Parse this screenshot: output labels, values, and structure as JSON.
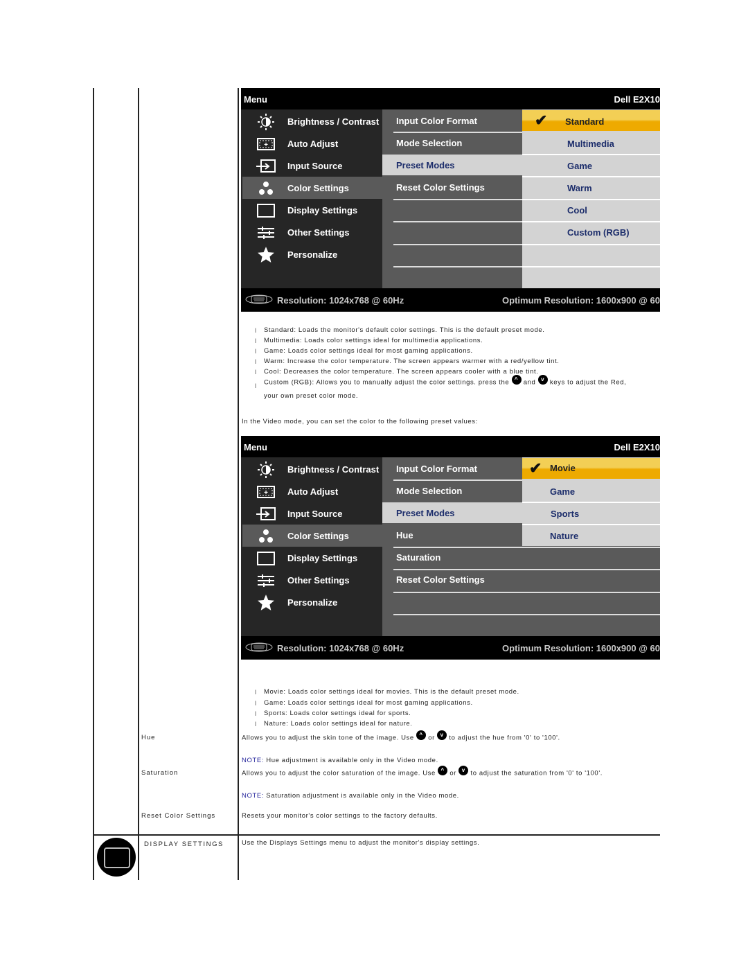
{
  "osd1": {
    "menu_label": "Menu",
    "model": "Dell E2X10",
    "left_items": [
      {
        "label": "Brightness / Contrast",
        "icon": "brightness-icon"
      },
      {
        "label": "Auto Adjust",
        "icon": "auto-adjust-icon"
      },
      {
        "label": "Input Source",
        "icon": "input-source-icon"
      },
      {
        "label": "Color Settings",
        "icon": "color-settings-icon",
        "active": true
      },
      {
        "label": "Display Settings",
        "icon": "display-settings-icon"
      },
      {
        "label": "Other Settings",
        "icon": "other-settings-icon"
      },
      {
        "label": "Personalize",
        "icon": "star-icon"
      }
    ],
    "mid_items": [
      "Input Color Format",
      "Mode Selection",
      "Preset Modes",
      "Reset Color Settings"
    ],
    "mid_selected": "Preset Modes",
    "right_items": [
      "Standard",
      "Multimedia",
      "Game",
      "Warm",
      "Cool",
      "Custom (RGB)"
    ],
    "right_selected": "Standard",
    "resolution": "Resolution: 1024x768 @ 60Hz",
    "optimum": "Optimum Resolution: 1600x900 @ 60"
  },
  "graphics_modes": [
    "Standard: Loads the monitor's default color settings. This is the default preset mode.",
    "Multimedia: Loads color settings ideal for multimedia applications.",
    "Game: Loads color settings ideal for most gaming applications.",
    "Warm: Increase the color temperature. The screen appears warmer with a red/yellow tint.",
    "Cool: Decreases the color temperature. The screen appears cooler with a blue tint."
  ],
  "custom_rgb": {
    "part1": "Custom (RGB): Allows you to manually adjust the color settings. press the",
    "and": "and",
    "part2": "keys to adjust the Red,",
    "line2": "your own preset color mode."
  },
  "video_intro": "In the Video mode, you can set the color to the following preset values:",
  "osd2": {
    "menu_label": "Menu",
    "model": "Dell E2X10",
    "left_items": [
      {
        "label": "Brightness / Contrast"
      },
      {
        "label": "Auto Adjust"
      },
      {
        "label": "Input Source"
      },
      {
        "label": "Color Settings",
        "active": true
      },
      {
        "label": "Display Settings"
      },
      {
        "label": "Other Settings"
      },
      {
        "label": "Personalize"
      }
    ],
    "mid_items": [
      "Input Color Format",
      "Mode Selection",
      "Preset Modes",
      "Hue",
      "Saturation",
      "Reset Color Settings"
    ],
    "mid_selected": "Preset Modes",
    "right_items": [
      "Movie",
      "Game",
      "Sports",
      "Nature"
    ],
    "right_selected": "Movie",
    "resolution": "Resolution: 1024x768 @ 60Hz",
    "optimum": "Optimum Resolution: 1600x900 @ 60"
  },
  "video_modes": [
    "Movie: Loads color settings ideal for movies. This is the default preset mode.",
    "Game: Loads color settings ideal for most gaming applications.",
    "Sports: Loads color settings ideal for sports.",
    "Nature: Loads color settings ideal for nature."
  ],
  "hue": {
    "label": "Hue",
    "text1": "Allows you to adjust the skin tone of the image. Use",
    "or": "or",
    "text2": "to adjust the hue from '0' to '100'.",
    "note_label": "NOTE:",
    "note": "Hue adjustment is available only in the Video mode."
  },
  "saturation": {
    "label": "Saturation",
    "text1": "Allows you to adjust the color saturation of the image. Use",
    "or": "or",
    "text2": "to adjust the saturation from '0' to '100'.",
    "note_label": "NOTE:",
    "note": "Saturation adjustment is available only in the Video mode."
  },
  "reset": {
    "label": "Reset Color Settings",
    "text": "Resets your monitor's color settings to the factory defaults."
  },
  "display_settings": {
    "label": "DISPLAY SETTINGS",
    "text": "Use the Displays Settings menu to adjust the monitor's display settings."
  },
  "bullet_glyph": "l",
  "up_key": "^",
  "down_key": "v"
}
